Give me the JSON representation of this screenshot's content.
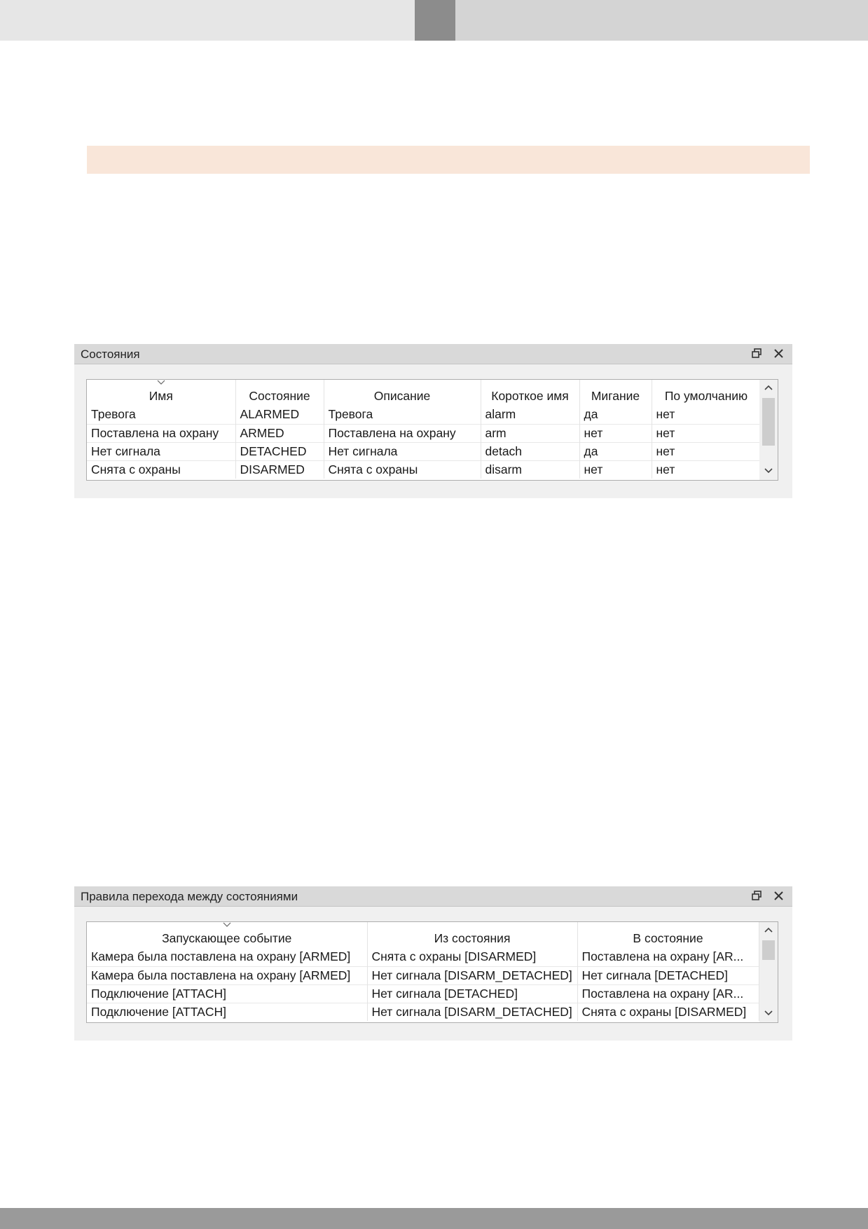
{
  "states_panel": {
    "title": "Состояния",
    "columns": [
      "Имя",
      "Состояние",
      "Описание",
      "Короткое имя",
      "Мигание",
      "По умолчанию"
    ],
    "rows": [
      [
        "Тревога",
        "ALARMED",
        "Тревога",
        "alarm",
        "да",
        "нет"
      ],
      [
        "Поставлена на охрану",
        "ARMED",
        "Поставлена на охрану",
        "arm",
        "нет",
        "нет"
      ],
      [
        "Нет сигнала",
        "DETACHED",
        "Нет сигнала",
        "detach",
        "да",
        "нет"
      ],
      [
        "Снята с охраны",
        "DISARMED",
        "Снята с охраны",
        "disarm",
        "нет",
        "нет"
      ]
    ]
  },
  "rules_panel": {
    "title": "Правила перехода между состояниями",
    "columns": [
      "Запускающее событие",
      "Из состояния",
      "В состояние"
    ],
    "rows": [
      [
        "Камера была поставлена на охрану [ARMED]",
        "Снята с охраны [DISARMED]",
        "Поставлена на охрану [AR..."
      ],
      [
        "Камера была поставлена на охрану [ARMED]",
        "Нет сигнала [DISARM_DETACHED]",
        "Нет сигнала [DETACHED]"
      ],
      [
        "Подключение [ATTACH]",
        "Нет сигнала [DETACHED]",
        "Поставлена на охрану [AR..."
      ],
      [
        "Подключение [ATTACH]",
        "Нет сигнала [DISARM_DETACHED]",
        "Снята с охраны [DISARMED]"
      ]
    ]
  },
  "icons": {
    "float": "restore-window-icon",
    "close": "close-icon",
    "sort": "sort-indicator-icon",
    "scroll_up": "chevron-up-icon",
    "scroll_down": "chevron-down-icon"
  }
}
